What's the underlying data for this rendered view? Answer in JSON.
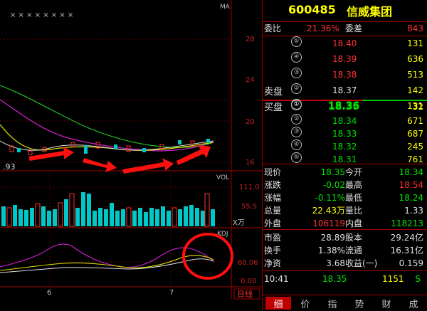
{
  "chart": {
    "ma_label": "MA",
    "vol_label": "VOL",
    "kdj_label": "KDJ",
    "vol_unit": "X万",
    "price_ticks": [
      "28",
      "24",
      "20",
      "16"
    ],
    "vol_ticks": [
      "111.0",
      "55.5"
    ],
    "kdj_ticks": [
      "60.06",
      "0.00"
    ],
    "date_labels": [
      "6",
      "7"
    ],
    "period_label": "日线",
    "last_price_marker": ".93",
    "top_marks": "× × × × × × × ×"
  },
  "stock": {
    "code": "600485",
    "name": "信威集团"
  },
  "order_ratio": {
    "label": "委比",
    "value": "21.36%",
    "diff_label": "委差",
    "diff": "843"
  },
  "sell": [
    {
      "level": "⑤",
      "price": "18.40",
      "vol": "131",
      "color": "#ff3030"
    },
    {
      "level": "④",
      "price": "18.39",
      "vol": "636",
      "color": "#ff3030"
    },
    {
      "level": "③",
      "price": "18.38",
      "vol": "513",
      "color": "#ff3030"
    },
    {
      "level": "②",
      "price": "18.37",
      "vol": "142",
      "color": "#e0e0e0"
    },
    {
      "level": "①",
      "price": "18.36",
      "vol": "131",
      "color": "#00e000"
    }
  ],
  "sell_label": "卖盘",
  "buy_label": "买盘",
  "buy": [
    {
      "level": "①",
      "price": "18.35",
      "vol": "32"
    },
    {
      "level": "②",
      "price": "18.34",
      "vol": "671"
    },
    {
      "level": "③",
      "price": "18.33",
      "vol": "687"
    },
    {
      "level": "④",
      "price": "18.32",
      "vol": "245"
    },
    {
      "level": "⑤",
      "price": "18.31",
      "vol": "761"
    }
  ],
  "stats": [
    {
      "l1": "现价",
      "v1": "18.35",
      "c1": "#00e000",
      "l2": "今开",
      "v2": "18.34",
      "c2": "#00e000"
    },
    {
      "l1": "涨跌",
      "v1": "-0.02",
      "c1": "#00e000",
      "l2": "最高",
      "v2": "18.54",
      "c2": "#ff3030"
    },
    {
      "l1": "涨幅",
      "v1": "-0.11%",
      "c1": "#00e000",
      "l2": "最低",
      "v2": "18.24",
      "c2": "#00e000"
    },
    {
      "l1": "总量",
      "v1": "22.43万",
      "c1": "#ffff00",
      "l2": "量比",
      "v2": "1.33",
      "c2": "#e0e0e0"
    },
    {
      "l1": "外盘",
      "v1": "106119",
      "c1": "#ff3030",
      "l2": "内盘",
      "v2": "118213",
      "c2": "#00e000"
    }
  ],
  "fundamentals": [
    {
      "l1": "市盈",
      "v1": "28.89",
      "l2": "股本",
      "v2": "29.24亿"
    },
    {
      "l1": "换手",
      "v1": "1.38%",
      "l2": "流通",
      "v2": "16.31亿"
    },
    {
      "l1": "净资",
      "v1": "3.68",
      "l2": "收益(一)",
      "v2": "0.159"
    }
  ],
  "tick": {
    "time": "10:41",
    "price": "18.35",
    "vol": "1151",
    "side": "S"
  },
  "tabs": [
    "细",
    "价",
    "指",
    "势",
    "财",
    "成"
  ]
}
